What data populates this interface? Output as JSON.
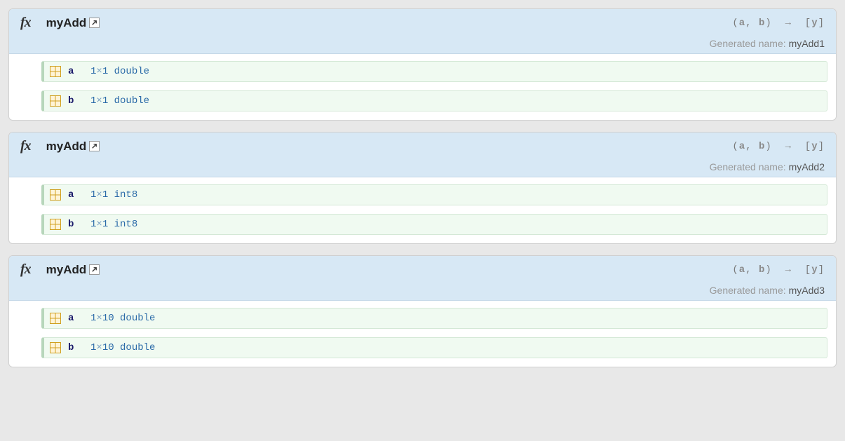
{
  "generated_label": "Generated name:",
  "signature": {
    "open": "(",
    "p1": "a",
    "comma": ",",
    "p2": "b",
    "close": ")",
    "arrow": "→",
    "ret_open": "[",
    "ret": "y",
    "ret_close": "]"
  },
  "entries": [
    {
      "fn_name": "myAdd",
      "generated_name": "myAdd1",
      "args": [
        {
          "name": "a",
          "dim1": "1",
          "dim2": "1",
          "dtype": "double"
        },
        {
          "name": "b",
          "dim1": "1",
          "dim2": "1",
          "dtype": "double"
        }
      ]
    },
    {
      "fn_name": "myAdd",
      "generated_name": "myAdd2",
      "args": [
        {
          "name": "a",
          "dim1": "1",
          "dim2": "1",
          "dtype": "int8"
        },
        {
          "name": "b",
          "dim1": "1",
          "dim2": "1",
          "dtype": "int8"
        }
      ]
    },
    {
      "fn_name": "myAdd",
      "generated_name": "myAdd3",
      "args": [
        {
          "name": "a",
          "dim1": "1",
          "dim2": "10",
          "dtype": "double"
        },
        {
          "name": "b",
          "dim1": "1",
          "dim2": "10",
          "dtype": "double"
        }
      ]
    }
  ]
}
